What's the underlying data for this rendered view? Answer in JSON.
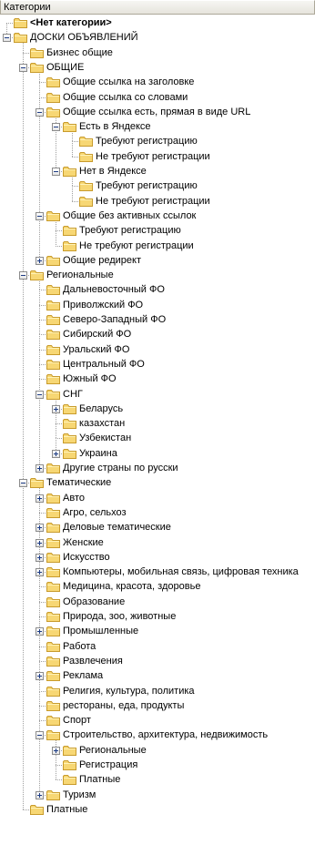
{
  "title": "Категории",
  "icons": {
    "folder": "folder-icon",
    "expand": "expand-icon",
    "collapse": "collapse-icon"
  },
  "colors": {
    "folder_fill": "#f7d774",
    "folder_stroke": "#c89b2c",
    "line": "#a0a0a0"
  },
  "items": [
    {
      "label": "<Нет категории>",
      "level": 0,
      "exp": null,
      "bold": true
    },
    {
      "label": "ДОСКИ ОБЪЯВЛЕНИЙ",
      "level": 0,
      "exp": "minus"
    },
    {
      "label": "Бизнес общие",
      "level": 1,
      "exp": null
    },
    {
      "label": "ОБЩИЕ",
      "level": 1,
      "exp": "minus"
    },
    {
      "label": "Общие ссылка на заголовке",
      "level": 2,
      "exp": null
    },
    {
      "label": "Общие ссылка со словами",
      "level": 2,
      "exp": null
    },
    {
      "label": "Общие ссылка есть, прямая в виде URL",
      "level": 2,
      "exp": "minus"
    },
    {
      "label": "Есть в Яндексе",
      "level": 3,
      "exp": "minus"
    },
    {
      "label": "Требуют регистрацию",
      "level": 4,
      "exp": null
    },
    {
      "label": "Не требуют регистрации",
      "level": 4,
      "exp": null
    },
    {
      "label": "Нет в Яндексе",
      "level": 3,
      "exp": "minus"
    },
    {
      "label": "Требуют регистрацию",
      "level": 4,
      "exp": null
    },
    {
      "label": "Не требуют регистрации",
      "level": 4,
      "exp": null
    },
    {
      "label": "Общие без активных ссылок",
      "level": 2,
      "exp": "minus"
    },
    {
      "label": "Требуют регистрацию",
      "level": 3,
      "exp": null
    },
    {
      "label": "Не требуют регистрации",
      "level": 3,
      "exp": null
    },
    {
      "label": "Общие редирект",
      "level": 2,
      "exp": "plus"
    },
    {
      "label": "Региональные",
      "level": 1,
      "exp": "minus"
    },
    {
      "label": "Дальневосточный ФО",
      "level": 2,
      "exp": null
    },
    {
      "label": "Приволжский ФО",
      "level": 2,
      "exp": null
    },
    {
      "label": "Северо-Западный ФО",
      "level": 2,
      "exp": null
    },
    {
      "label": "Сибирский ФО",
      "level": 2,
      "exp": null
    },
    {
      "label": "Уральский ФО",
      "level": 2,
      "exp": null
    },
    {
      "label": "Центральный ФО",
      "level": 2,
      "exp": null
    },
    {
      "label": "Южный ФО",
      "level": 2,
      "exp": null
    },
    {
      "label": "СНГ",
      "level": 2,
      "exp": "minus"
    },
    {
      "label": "Беларусь",
      "level": 3,
      "exp": "plus"
    },
    {
      "label": "казахстан",
      "level": 3,
      "exp": null
    },
    {
      "label": "Узбекистан",
      "level": 3,
      "exp": null
    },
    {
      "label": "Украина",
      "level": 3,
      "exp": "plus"
    },
    {
      "label": "Другие страны по русски",
      "level": 2,
      "exp": "plus"
    },
    {
      "label": "Тематические",
      "level": 1,
      "exp": "minus"
    },
    {
      "label": "Авто",
      "level": 2,
      "exp": "plus"
    },
    {
      "label": "Агро, сельхоз",
      "level": 2,
      "exp": null
    },
    {
      "label": "Деловые тематические",
      "level": 2,
      "exp": "plus"
    },
    {
      "label": "Женские",
      "level": 2,
      "exp": "plus"
    },
    {
      "label": "Искусство",
      "level": 2,
      "exp": "plus"
    },
    {
      "label": "Компьютеры, мобильная связь, цифровая техника",
      "level": 2,
      "exp": "plus"
    },
    {
      "label": "Медицина, красота, здоровье",
      "level": 2,
      "exp": null
    },
    {
      "label": "Образование",
      "level": 2,
      "exp": null
    },
    {
      "label": "Природа, зоо, животные",
      "level": 2,
      "exp": null
    },
    {
      "label": "Промышленные",
      "level": 2,
      "exp": "plus"
    },
    {
      "label": "Работа",
      "level": 2,
      "exp": null
    },
    {
      "label": "Развлечения",
      "level": 2,
      "exp": null
    },
    {
      "label": "Реклама",
      "level": 2,
      "exp": "plus"
    },
    {
      "label": "Религия, культура, политика",
      "level": 2,
      "exp": null
    },
    {
      "label": "рестораны, еда, продукты",
      "level": 2,
      "exp": null
    },
    {
      "label": "Спорт",
      "level": 2,
      "exp": null
    },
    {
      "label": "Строительство, архитектура, недвижимость",
      "level": 2,
      "exp": "minus"
    },
    {
      "label": "Региональные",
      "level": 3,
      "exp": "plus"
    },
    {
      "label": "Регистрация",
      "level": 3,
      "exp": null
    },
    {
      "label": "Платные",
      "level": 3,
      "exp": null
    },
    {
      "label": "Туризм",
      "level": 2,
      "exp": "plus"
    },
    {
      "label": "Платные",
      "level": 1,
      "exp": null
    }
  ]
}
